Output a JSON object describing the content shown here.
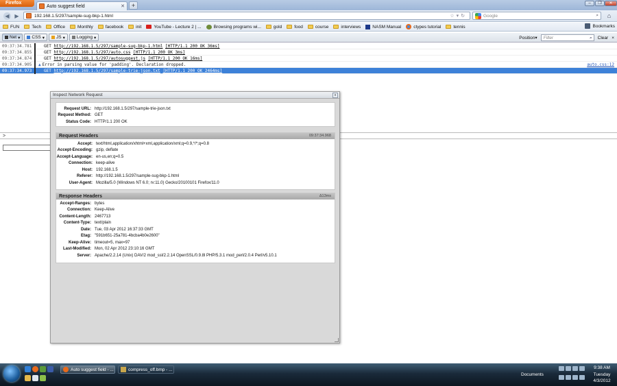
{
  "browser": {
    "app_button": "Firefox",
    "tab_title": "Auto suggest field",
    "new_tab": "+",
    "url": "192.168.1.5/297/sample-sug-bkp-1.html",
    "search_placeholder": "Google",
    "accent": "#e8752a"
  },
  "bookmarks": {
    "items": [
      {
        "label": "FUN",
        "icon": "folder-icon"
      },
      {
        "label": "Tech",
        "icon": "folder-icon"
      },
      {
        "label": "Office",
        "icon": "folder-icon"
      },
      {
        "label": "Monthly",
        "icon": "folder-icon"
      },
      {
        "label": "facebook",
        "icon": "folder-icon"
      },
      {
        "label": "init",
        "icon": "folder-icon"
      },
      {
        "label": "YouTube - Lecture 2 | ...",
        "icon": "youtube-icon"
      },
      {
        "label": "Browsing programs wi...",
        "icon": "bug-icon"
      },
      {
        "label": "gold",
        "icon": "folder-icon"
      },
      {
        "label": "food",
        "icon": "folder-icon"
      },
      {
        "label": "course",
        "icon": "folder-icon"
      },
      {
        "label": "interviews",
        "icon": "folder-icon"
      },
      {
        "label": "NASM Manual",
        "icon": "nasm-icon"
      },
      {
        "label": "ctypes tutorial",
        "icon": "firefox-icon"
      },
      {
        "label": "tennis",
        "icon": "folder-icon"
      }
    ],
    "right_label": "Bookmarks"
  },
  "firebug": {
    "tabs": [
      "Net",
      "CSS",
      "JS",
      "Logging"
    ],
    "position_label": "Position",
    "filter_placeholder": "Filter",
    "clear_label": "Clear",
    "close": "×",
    "log": [
      {
        "time": "09:37:34.781",
        "method": "GET",
        "url": "http://192.168.1.5/297/sample-sug-bkp-1.html",
        "status": "[HTTP/1.1 200 OK 36ms]"
      },
      {
        "time": "09:37:34.855",
        "method": "GET",
        "url": "http://192.168.1.5/297/auto.css",
        "status": "[HTTP/1.1 200 OK 3ms]"
      },
      {
        "time": "09:37:34.874",
        "method": "GET",
        "url": "http://192.168.1.5/297/autosuggest.js",
        "status": "[HTTP/1.1 200 OK 16ms]"
      },
      {
        "time": "09:37:34.905",
        "message": "Error in parsing value for 'padding'.  Declaration dropped.",
        "source": "auto.css:12"
      },
      {
        "time": "09:37:34.973",
        "method": "GET",
        "url": "http://192.168.1.5/297/sample-trie-json.txt",
        "status": "[HTTP/1.1 200 OK 2464ms]"
      }
    ],
    "prompt": ">"
  },
  "dialog": {
    "title": "Inspect Network Request",
    "close": "x",
    "request": [
      {
        "k": "Request URL:",
        "v": "http://192.168.1.5/297/sample-trie-json.txt"
      },
      {
        "k": "Request Method:",
        "v": "GET"
      },
      {
        "k": "Status Code:",
        "v": "HTTP/1.1 200 OK"
      }
    ],
    "request_headers_title": "Request Headers",
    "request_headers_time": "09:37:34.968",
    "request_headers": [
      {
        "k": "Accept:",
        "v": "text/html,application/xhtml+xml,application/xml;q=0.9,*/*;q=0.8"
      },
      {
        "k": "Accept-Encoding:",
        "v": "gzip, deflate"
      },
      {
        "k": "Accept-Language:",
        "v": "en-us,en;q=0.5"
      },
      {
        "k": "Connection:",
        "v": "keep-alive"
      },
      {
        "k": "Host:",
        "v": "192.168.1.5"
      },
      {
        "k": "Referer:",
        "v": "http://192.168.1.5/297/sample-sug-bkp-1.html"
      },
      {
        "k": "User-Agent:",
        "v": "Mozilla/5.0 (Windows NT 6.0; rv:11.0) Gecko/20100101 Firefox/11.0"
      }
    ],
    "response_headers_title": "Response Headers",
    "response_headers_time": "Δ13ms",
    "response_headers": [
      {
        "k": "Accept-Ranges:",
        "v": "bytes"
      },
      {
        "k": "Connection:",
        "v": "Keep-Alive"
      },
      {
        "k": "Content-Length:",
        "v": "2467713"
      },
      {
        "k": "Content-Type:",
        "v": "text/plain"
      },
      {
        "k": "Date:",
        "v": "Tue, 03 Apr 2012 16:37:33 GMT"
      },
      {
        "k": "Etag:",
        "v": "\"591b651-25a781-4bcba4b0e2600\""
      },
      {
        "k": "Keep-Alive:",
        "v": "timeout=5, max=97"
      },
      {
        "k": "Last-Modified:",
        "v": "Mon, 02 Apr 2012 23:10:16 GMT"
      },
      {
        "k": "Server:",
        "v": "Apache/2.2.14 (Unix) DAV/2 mod_ssl/2.2.14 OpenSSL/0.9.8l PHP/5.3.1 mod_perl/2.0.4 Perl/v5.10.1"
      }
    ]
  },
  "taskbar": {
    "buttons": [
      {
        "label": "Auto suggest field - ...",
        "icon": "firefox-icon"
      },
      {
        "label": "compress_off.bmp - ...",
        "icon": "paint-icon"
      }
    ],
    "documents_label": "Documents",
    "time": "9:38 AM",
    "day": "Tuesday",
    "date": "4/3/2012"
  }
}
